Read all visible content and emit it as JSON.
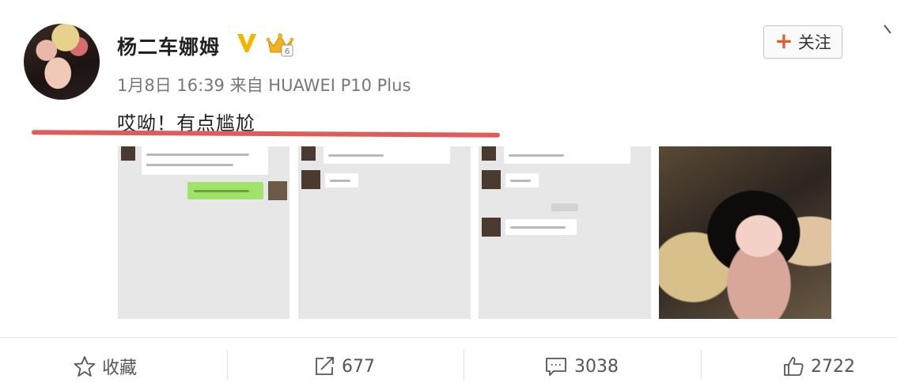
{
  "post": {
    "username": "杨二车娜姆",
    "timestamp": "1月8日 16:39",
    "source_prefix": "来自",
    "source_device": "HUAWEI P10 Plus",
    "text": "哎呦！有点尴尬",
    "follow_label": "关注",
    "follow_plus": "+"
  },
  "actions": {
    "favorite_label": "收藏",
    "repost_count": "677",
    "comment_count": "3038",
    "like_count": "2722"
  },
  "colors": {
    "verify_badge": "#f4b400",
    "highlight_line": "#e35a5a",
    "follow_plus": "#e35c2c",
    "chat_green": "#9fe36a"
  },
  "icons": [
    "verified-v-icon",
    "crown-badge-icon",
    "chevron-down-icon",
    "star-icon",
    "share-icon",
    "comment-icon",
    "thumbs-up-icon"
  ]
}
